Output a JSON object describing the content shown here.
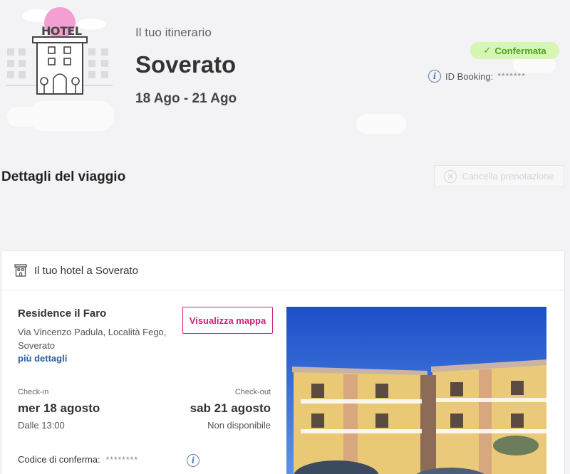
{
  "header": {
    "subtitle": "Il tuo itinerario",
    "city": "Soverato",
    "dates": "18 Ago - 21 Ago",
    "hotel_sign": "HOTEL",
    "status": "Confermata",
    "booking_id_label": "ID Booking:",
    "booking_id_value": "*******"
  },
  "trip": {
    "section_title": "Dettagli del viaggio",
    "cancel_label": "Cancella prenotazione"
  },
  "hotel_card": {
    "title": "Il tuo hotel a Soverato",
    "hotel_name": "Residence il Faro",
    "address": "Via Vincenzo Padula, Località Fego, Soverato",
    "more_details": "più dettagli",
    "map_button": "Visualizza mappa",
    "checkin_label": "Check-in",
    "checkin_date": "mer 18 agosto",
    "checkin_time": "Dalle 13:00",
    "checkout_label": "Check-out",
    "checkout_date": "sab 21 agosto",
    "checkout_time": "Non disponibile",
    "confirmation_label": "Codice di conferma:",
    "confirmation_value": "********"
  },
  "colors": {
    "accent": "#d11f74",
    "status_bg": "#d7f5b3",
    "status_text": "#4aa51e",
    "link": "#2d5f9e"
  },
  "icons": [
    "hotel-illustration",
    "check-icon",
    "info-icon",
    "cancel-x-icon",
    "hotel-building-icon"
  ]
}
